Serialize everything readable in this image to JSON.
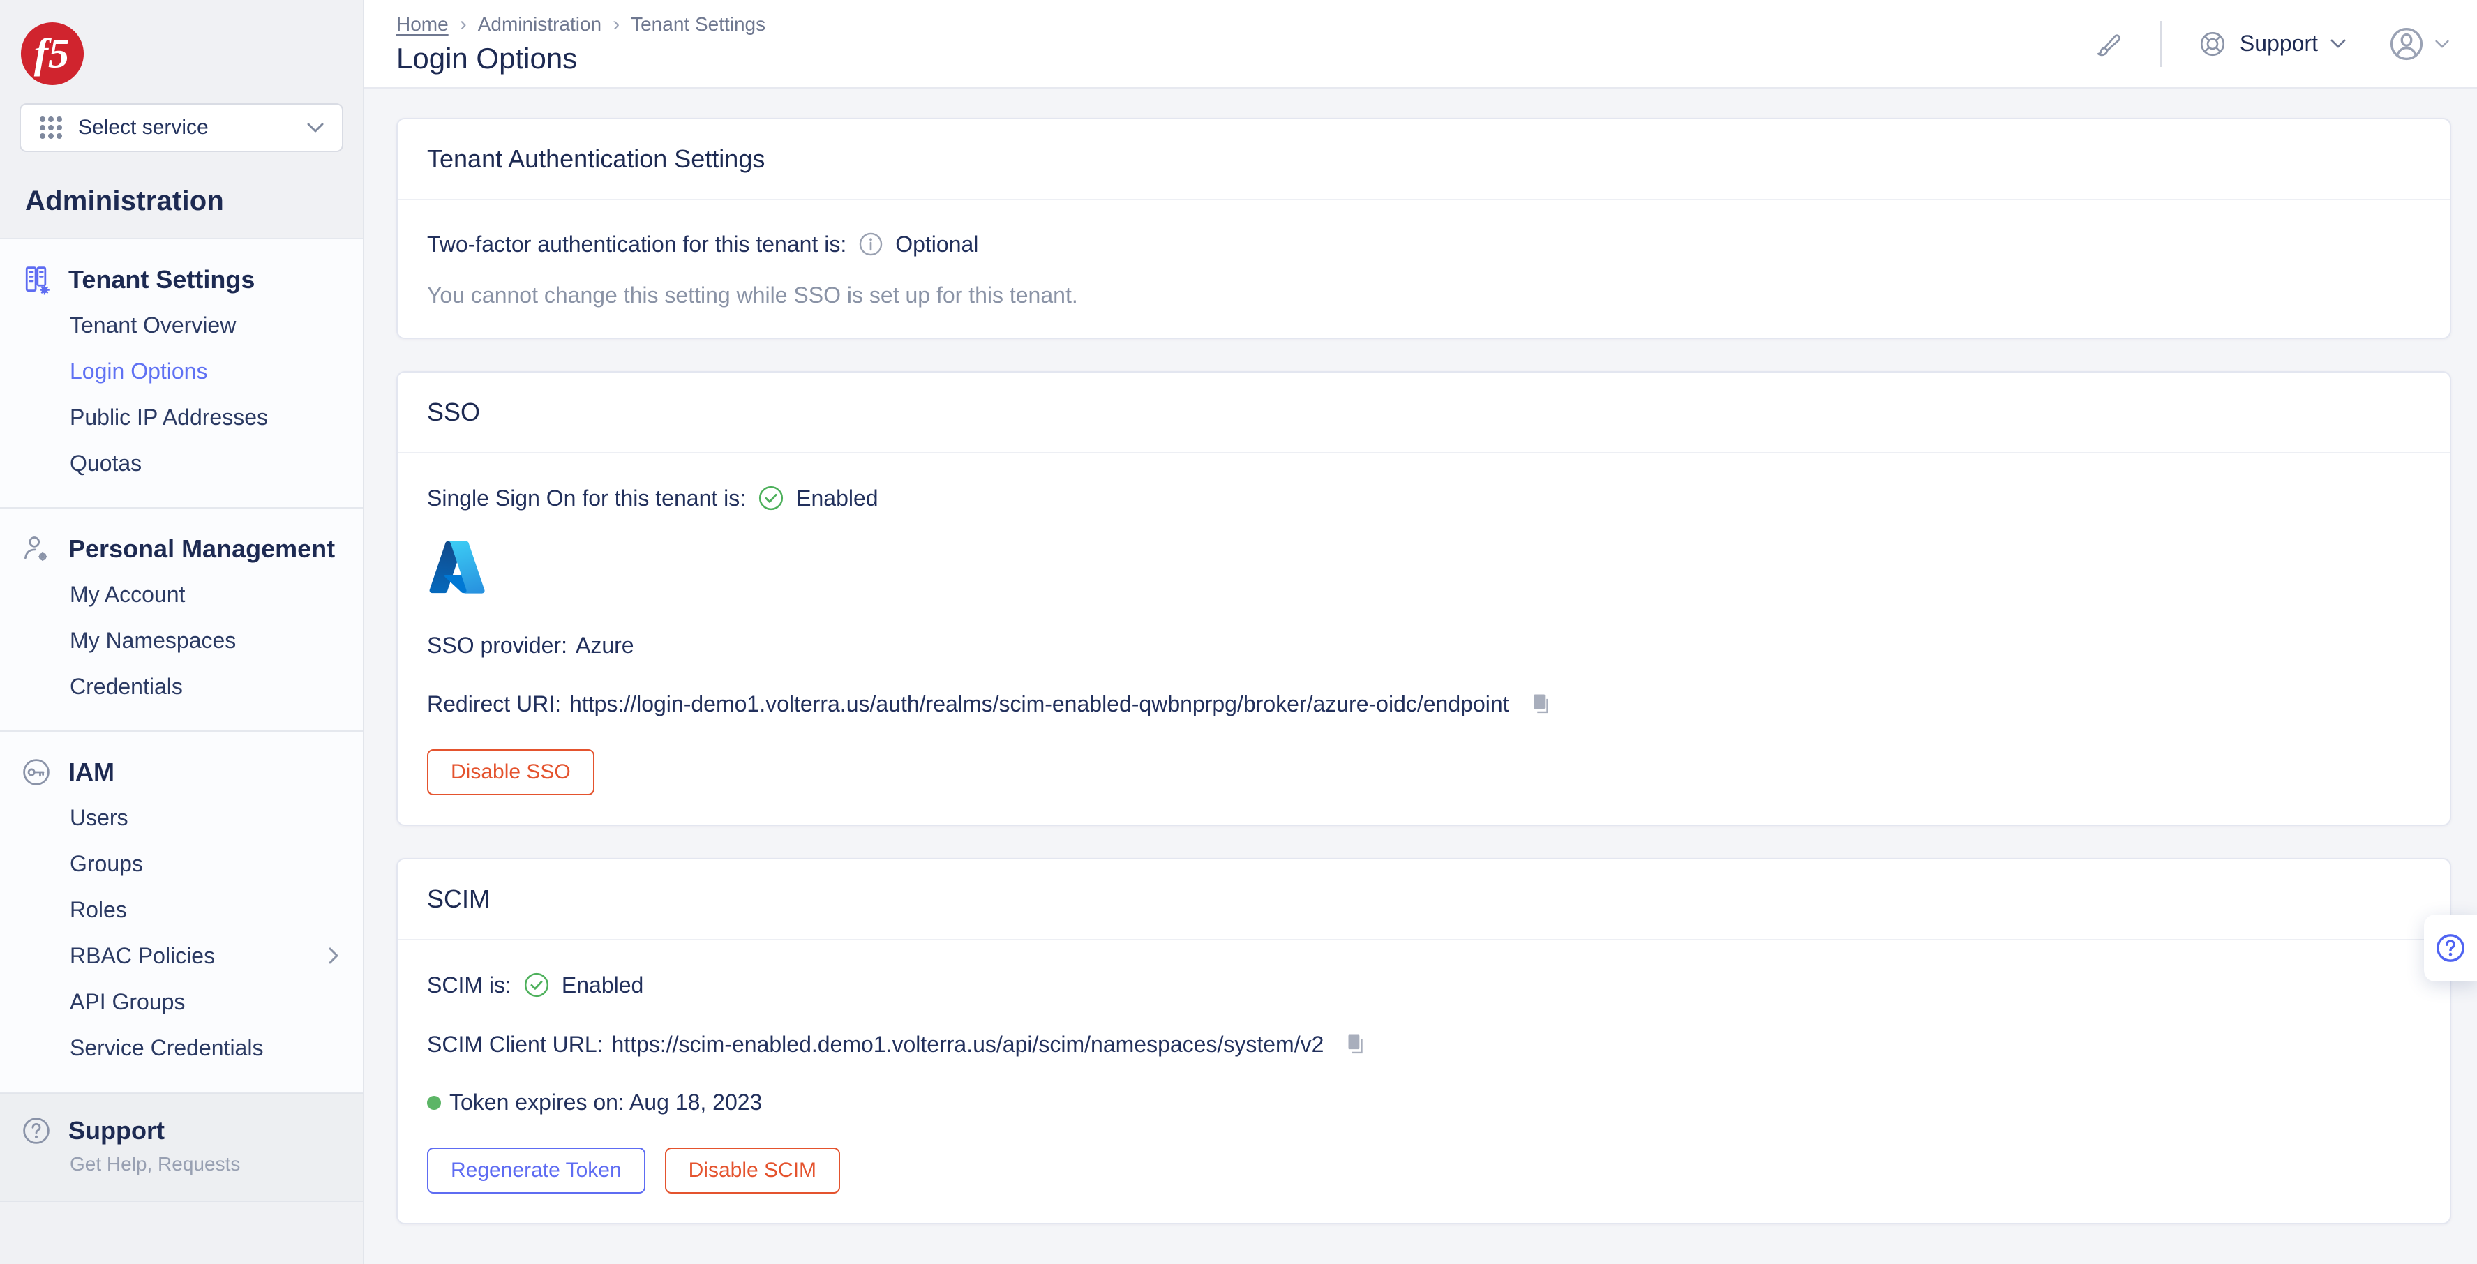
{
  "colors": {
    "accent_blue": "#5e6cf2",
    "danger_red": "#e4532e",
    "success_green": "#4db05b",
    "brand_red": "#d0242e",
    "navy_text": "#1d2a52"
  },
  "brand": {
    "logo_text": "f5"
  },
  "sidebar": {
    "select_service_label": "Select service",
    "title": "Administration",
    "groups": [
      {
        "title": "Tenant Settings",
        "icon": "building-gear-icon",
        "items": [
          "Tenant Overview",
          "Login Options",
          "Public IP Addresses",
          "Quotas"
        ],
        "active_item": "Login Options"
      },
      {
        "title": "Personal Management",
        "icon": "person-gear-icon",
        "items": [
          "My Account",
          "My Namespaces",
          "Credentials"
        ]
      },
      {
        "title": "IAM",
        "icon": "key-icon",
        "items": [
          "Users",
          "Groups",
          "Roles",
          "RBAC Policies",
          "API Groups",
          "Service Credentials"
        ]
      }
    ],
    "support": {
      "title": "Support",
      "subtitle": "Get Help, Requests"
    }
  },
  "header": {
    "breadcrumbs": [
      "Home",
      "Administration",
      "Tenant Settings"
    ],
    "separator": "›",
    "page_title": "Login Options",
    "support_label": "Support"
  },
  "cards": {
    "tenant_auth": {
      "title": "Tenant Authentication Settings",
      "two_factor_label": "Two-factor authentication for this tenant is:",
      "two_factor_value": "Optional",
      "note": "You cannot change this setting while SSO is set up for this tenant."
    },
    "sso": {
      "title": "SSO",
      "status_label": "Single Sign On for this tenant is:",
      "status_value": "Enabled",
      "provider_label": "SSO provider:",
      "provider_value": "Azure",
      "redirect_label": "Redirect URI:",
      "redirect_url": "https://login-demo1.volterra.us/auth/realms/scim-enabled-qwbnprpg/broker/azure-oidc/endpoint",
      "disable_button": "Disable SSO"
    },
    "scim": {
      "title": "SCIM",
      "status_label": "SCIM is:",
      "status_value": "Enabled",
      "client_url_label": "SCIM Client URL:",
      "client_url": "https://scim-enabled.demo1.volterra.us/api/scim/namespaces/system/v2",
      "token_label": "Token expires on: Aug 18, 2023",
      "regenerate_button": "Regenerate Token",
      "disable_button": "Disable SCIM"
    }
  }
}
